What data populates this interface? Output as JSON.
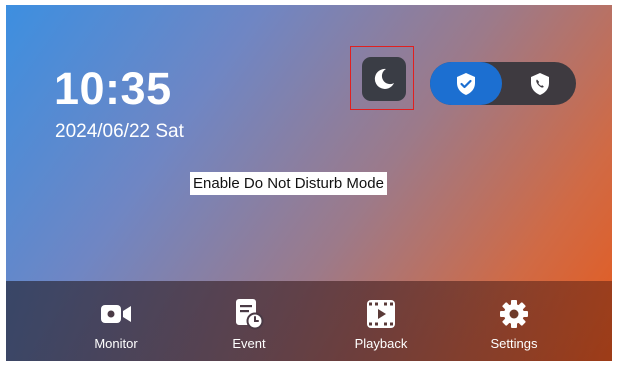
{
  "clock": {
    "time": "10:35",
    "date": "2024/06/22 Sat"
  },
  "quick_actions": {
    "do_not_disturb": {
      "icon": "moon-icon"
    },
    "mode_toggle": {
      "active": {
        "icon": "shield-check-icon",
        "color": "#1c6fd1"
      },
      "inactive": {
        "icon": "shield-phone-icon"
      }
    }
  },
  "tooltip": {
    "text": "Enable Do Not Disturb Mode"
  },
  "nav": {
    "items": [
      {
        "label": "Monitor",
        "icon": "video-camera-icon"
      },
      {
        "label": "Event",
        "icon": "event-log-icon"
      },
      {
        "label": "Playback",
        "icon": "film-play-icon"
      },
      {
        "label": "Settings",
        "icon": "gear-icon"
      }
    ]
  },
  "colors": {
    "accent": "#1c6fd1",
    "highlight": "#e02020",
    "dnd_button": "#3a3d45"
  }
}
